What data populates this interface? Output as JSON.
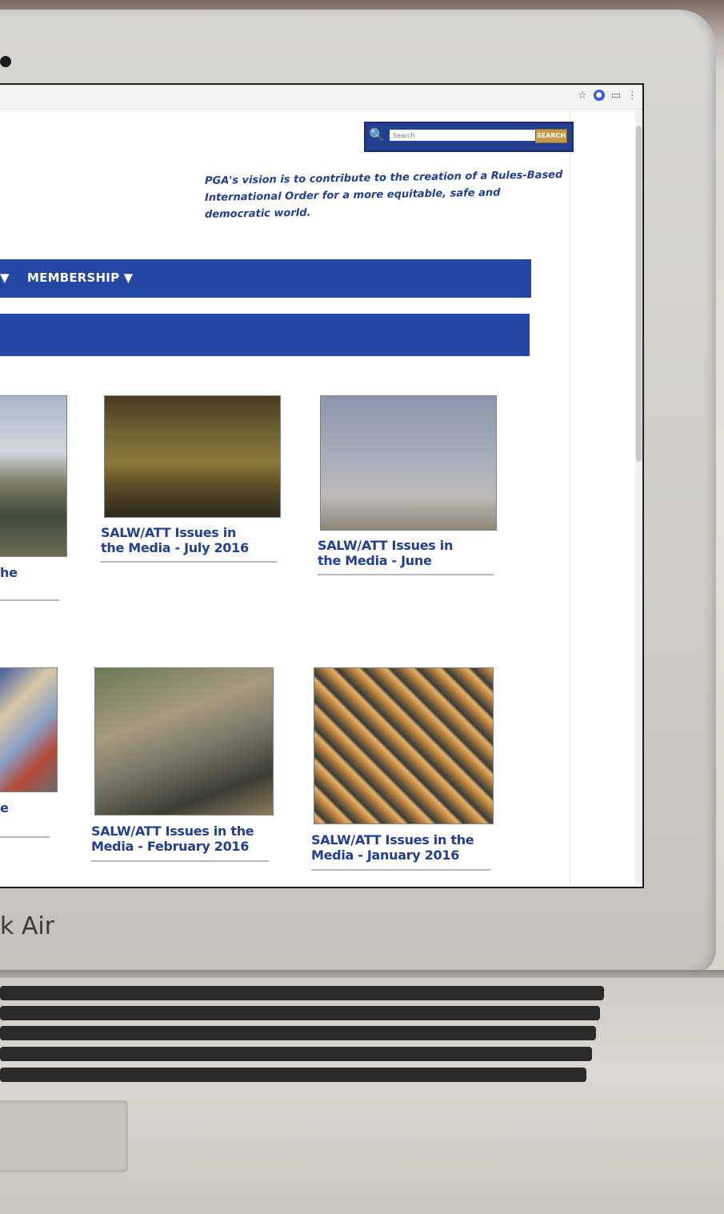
{
  "browser": {
    "icons": [
      "star-icon",
      "extension-icon",
      "cast-icon",
      "menu-dots-icon"
    ]
  },
  "search": {
    "placeholder": "Search",
    "button_label": "SEARCH"
  },
  "vision_text": "PGA's vision is to contribute to the creation of a Rules-Based International Order for a more equitable, safe and democratic world.",
  "nav": {
    "membership_label": "MEMBERSHIP ▼",
    "prev_arrow": "▼"
  },
  "cards": [
    {
      "title": "he",
      "image": "armored-vehicle-parade"
    },
    {
      "title": "SALW/ATT Issues in the Media - July 2016",
      "image": "weapons-crates"
    },
    {
      "title": "SALW/ATT Issues in the Media - June",
      "image": "soldier-binoculars"
    },
    {
      "title": "e",
      "image": "crowd-rally"
    },
    {
      "title": "SALW/ATT Issues in the Media - February 2016",
      "image": "collected-rifles"
    },
    {
      "title": "SALW/ATT Issues in the Media - January 2016",
      "image": "ammunition-belts"
    }
  ],
  "device": {
    "model_label": "k Air"
  },
  "colors": {
    "brand_blue": "#2347a2",
    "search_button": "#c49a4a",
    "title_blue": "#233f8f"
  }
}
